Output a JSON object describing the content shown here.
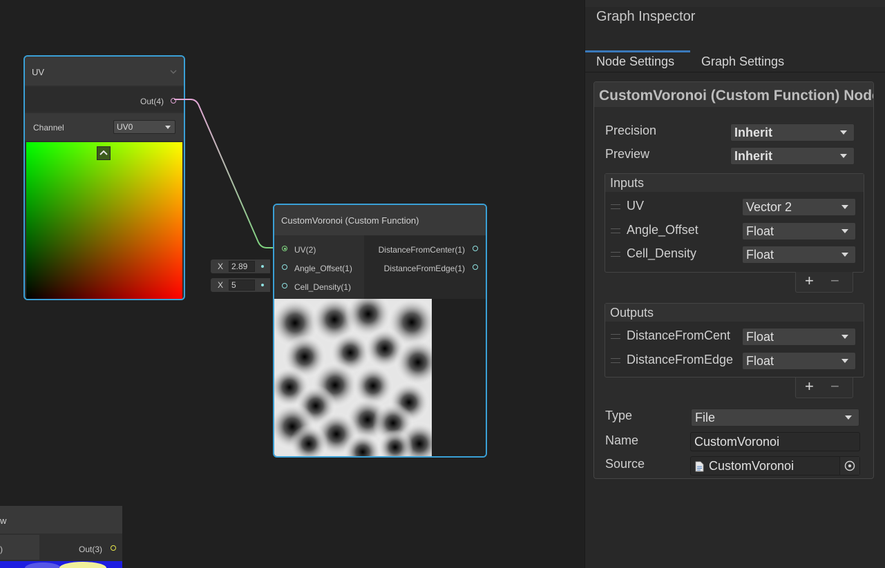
{
  "uv_node": {
    "title": "UV",
    "out_label": "Out(4)",
    "channel_label": "Channel",
    "channel_value": "UV0"
  },
  "voronoi_node": {
    "title": "CustomVoronoi (Custom Function)",
    "inputs": [
      "UV(2)",
      "Angle_Offset(1)",
      "Cell_Density(1)"
    ],
    "outputs": [
      "DistanceFromCenter(1)",
      "DistanceFromEdge(1)"
    ],
    "angle_offset": {
      "axis": "X",
      "value": "2.89"
    },
    "cell_density": {
      "axis": "X",
      "value": "5"
    }
  },
  "partial_node": {
    "title_fragment": "w",
    "left_fragment": ")",
    "out_label": "Out(3)"
  },
  "inspector": {
    "title": "Graph Inspector",
    "tabs": [
      "Node Settings",
      "Graph Settings"
    ],
    "active_tab": "Node Settings",
    "header": "CustomVoronoi (Custom Function) Node",
    "precision_label": "Precision",
    "precision_value": "Inherit",
    "preview_label": "Preview",
    "preview_value": "Inherit",
    "inputs_title": "Inputs",
    "inputs": [
      {
        "name": "UV",
        "type": "Vector 2"
      },
      {
        "name": "Angle_Offset",
        "type": "Float"
      },
      {
        "name": "Cell_Density",
        "type": "Float"
      }
    ],
    "outputs_title": "Outputs",
    "outputs": [
      {
        "name": "DistanceFromCent",
        "type": "Float"
      },
      {
        "name": "DistanceFromEdge",
        "type": "Float"
      }
    ],
    "plus": "+",
    "minus": "−",
    "type_label": "Type",
    "type_value": "File",
    "name_label": "Name",
    "name_value": "CustomVoronoi",
    "source_label": "Source",
    "source_value": "CustomVoronoi"
  },
  "colors": {
    "node_border": "#3aa0d6",
    "edge_start": "#e3a6d6",
    "edge_end": "#7fd27f",
    "port_cyan": "#8ee0e0",
    "port_yellow": "#e6e64a"
  }
}
